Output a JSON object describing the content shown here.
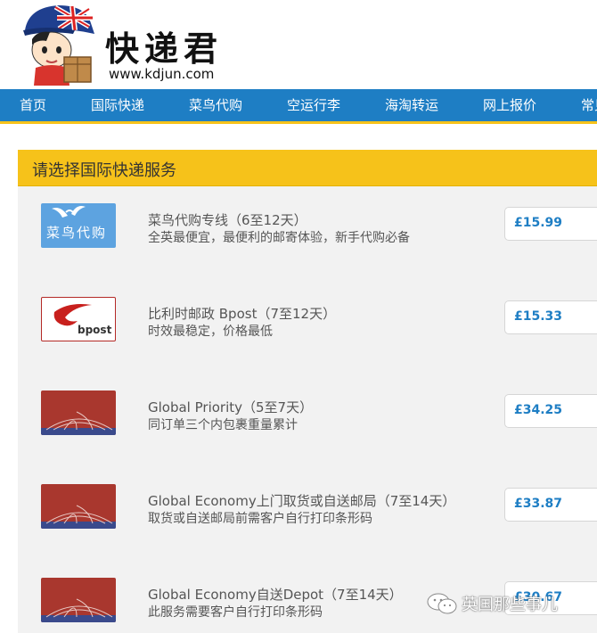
{
  "brand": {
    "title": "快递君",
    "url": "www.kdjun.com"
  },
  "nav": {
    "items": [
      {
        "label": "首页"
      },
      {
        "label": "国际快递"
      },
      {
        "label": "菜鸟代购"
      },
      {
        "label": "空运行李"
      },
      {
        "label": "海淘转运"
      },
      {
        "label": "网上报价"
      },
      {
        "label": "常见"
      }
    ]
  },
  "panel": {
    "title": "请选择国际快递服务"
  },
  "services": [
    {
      "logo": "菜鸟代购",
      "logo_icon": "wings-icon",
      "name": "菜鸟代购专线（6至12天）",
      "desc": "全英最便宜，最便利的邮寄体验，新手代购必备",
      "price": "£15.99"
    },
    {
      "logo": "bpost",
      "logo_icon": "bpost-horn-icon",
      "name": "比利时邮政 Bpost（7至12天）",
      "desc": "时效最稳定，价格最低",
      "price": "£15.33"
    },
    {
      "logo": "",
      "logo_icon": "royal-mail-globe-icon",
      "name": "Global Priority（5至7天）",
      "desc": "同订单三个内包裹重量累计",
      "price": "£34.25"
    },
    {
      "logo": "",
      "logo_icon": "royal-mail-globe-icon",
      "name": "Global Economy上门取货或自送邮局（7至14天）",
      "desc": "取货或自送邮局前需客户自行打印条形码",
      "price": "£33.87"
    },
    {
      "logo": "",
      "logo_icon": "royal-mail-globe-icon",
      "name": "Global Economy自送Depot（7至14天）",
      "desc": "此服务需要客户自行打印条形码",
      "price": "£30.67"
    }
  ],
  "watermark": {
    "text": "英国那些事儿"
  },
  "colors": {
    "nav_bg": "#1e7ec4",
    "accent_yellow": "#f6c21a",
    "price_blue": "#1e7ec4",
    "royal_mail_red": "#a9372e"
  }
}
